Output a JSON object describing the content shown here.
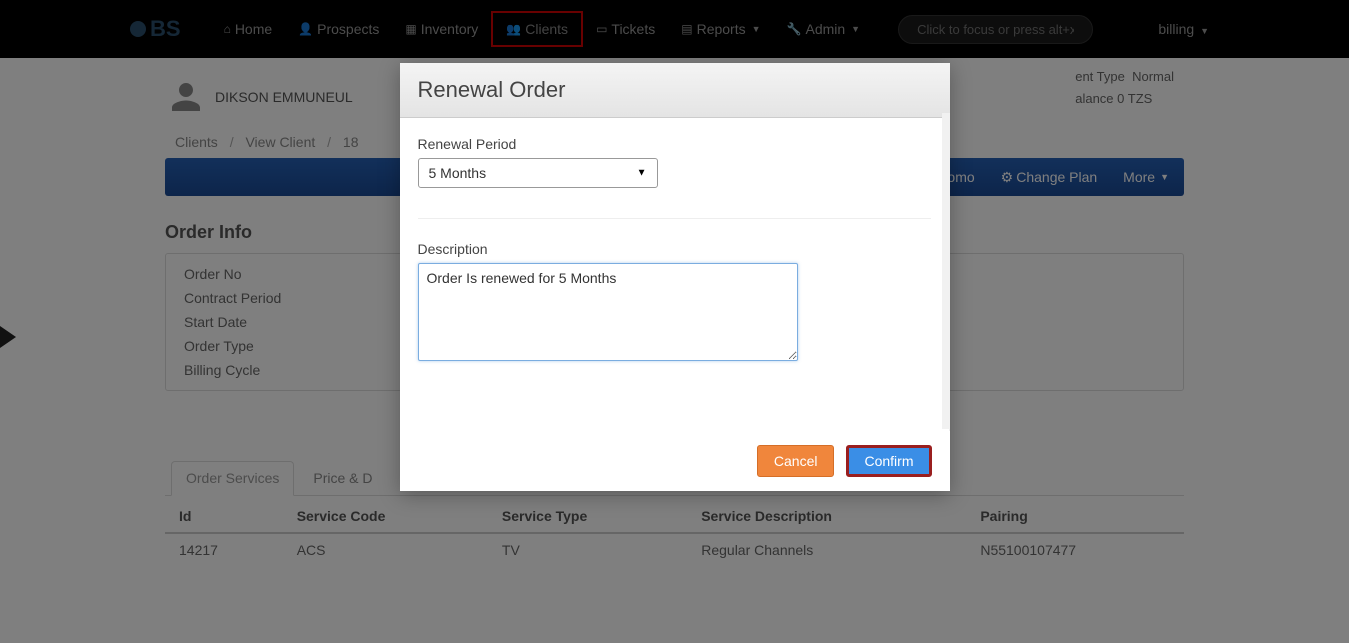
{
  "navbar": {
    "logo": "BS",
    "items": [
      {
        "label": "Home"
      },
      {
        "label": "Prospects"
      },
      {
        "label": "Inventory"
      },
      {
        "label": "Clients"
      },
      {
        "label": "Tickets"
      },
      {
        "label": "Reports"
      },
      {
        "label": "Admin"
      }
    ],
    "search_placeholder": "Click to focus or press alt+x",
    "right_label": "billing"
  },
  "client": {
    "name": "DIKSON EMMUNEUL",
    "type_label": "ent Type",
    "type_value": "Normal",
    "balance_label": "alance",
    "balance_value": "0 TZS"
  },
  "breadcrumb": {
    "a": "Clients",
    "b": "View Client",
    "c": "18"
  },
  "actions": {
    "promo": "Promo",
    "change_plan": "Change Plan",
    "more": "More"
  },
  "order": {
    "title": "Order Info",
    "rows": [
      "Order No",
      "Contract Period",
      "Start Date",
      "Order Type",
      "Billing Cycle"
    ]
  },
  "sub_tabs": {
    "a": "Order Services",
    "b": "Price & D"
  },
  "table": {
    "headers": [
      "Id",
      "Service Code",
      "Service Type",
      "Service Description",
      "Pairing"
    ],
    "row": [
      "14217",
      "ACS",
      "TV",
      "Regular Channels",
      "N55100107477"
    ]
  },
  "modal": {
    "title": "Renewal Order",
    "period_label": "Renewal Period",
    "period_value": "5 Months",
    "desc_label": "Description",
    "desc_value": "Order Is renewed for 5 Months",
    "cancel": "Cancel",
    "confirm": "Confirm"
  }
}
